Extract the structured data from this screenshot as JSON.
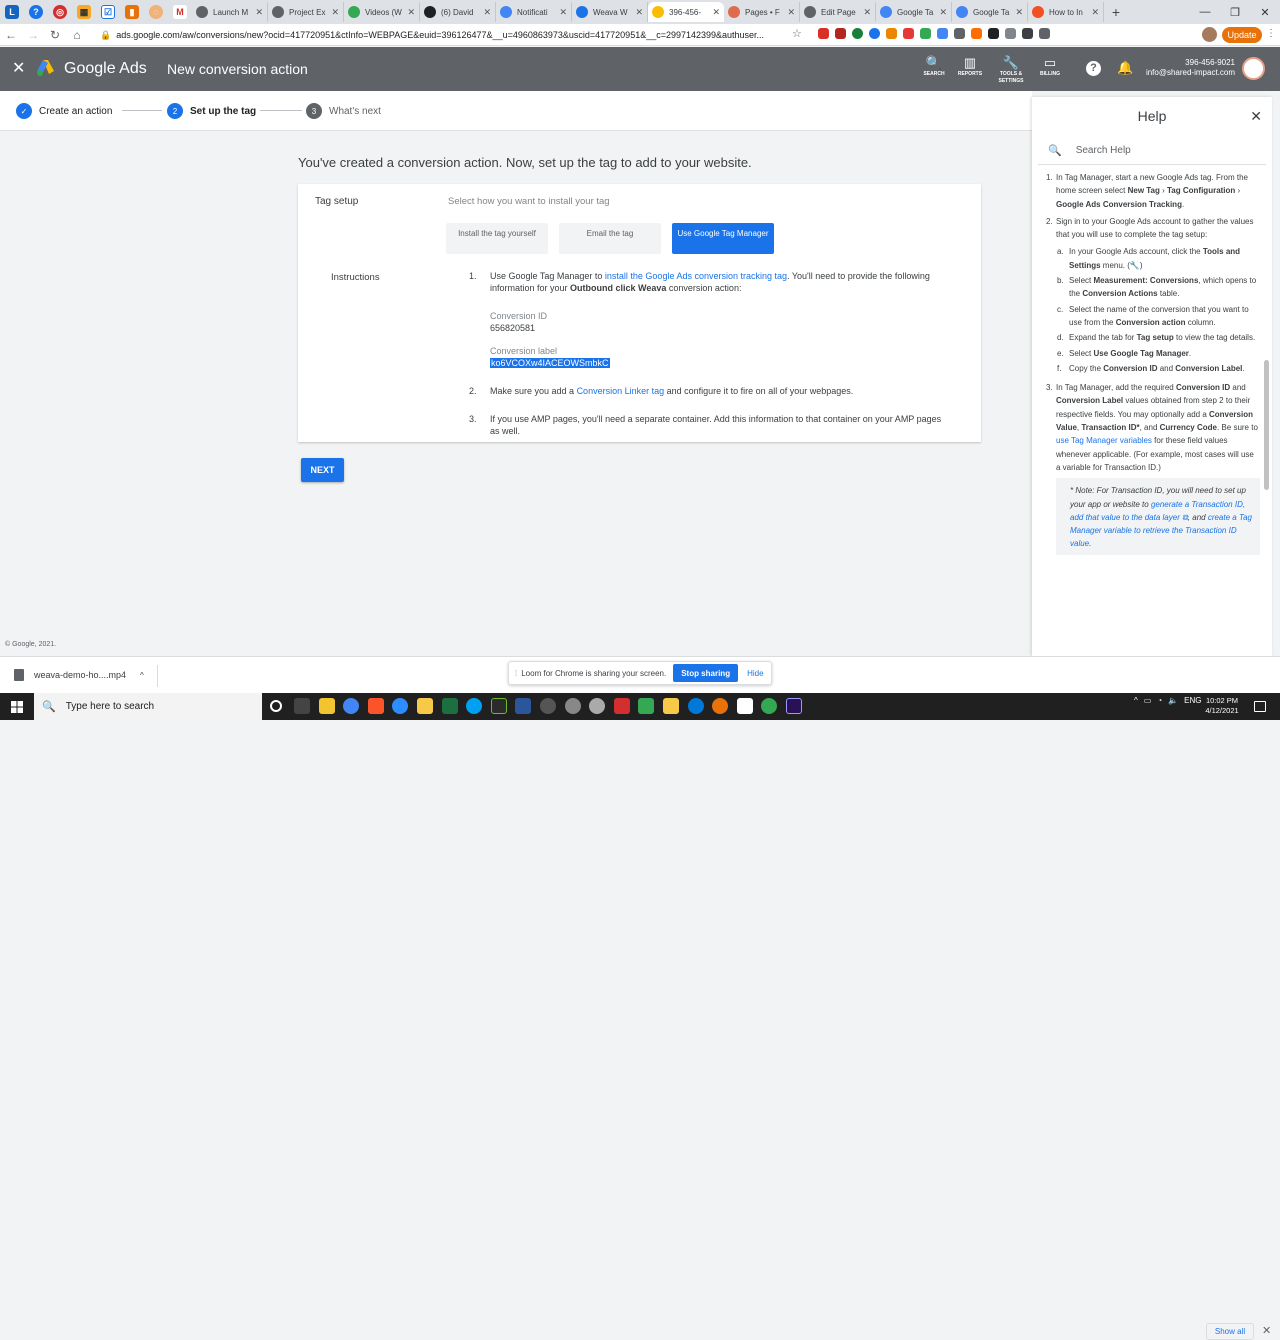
{
  "browser": {
    "tabs": [
      {
        "label": "Launch M",
        "color": "#5f6368"
      },
      {
        "label": "Project Ex",
        "color": "#5f6368"
      },
      {
        "label": "Videos (W",
        "color": "#34a853"
      },
      {
        "label": "(6) David",
        "color": "#202124"
      },
      {
        "label": "Notificati",
        "color": "#4285f4"
      },
      {
        "label": "Weava W",
        "color": "#1a73e8"
      },
      {
        "label": "396-456-",
        "color": "#fbbc04",
        "active": true
      },
      {
        "label": "Pages • F",
        "color": "#e06c4f"
      },
      {
        "label": "Edit Page",
        "color": "#5f6368"
      },
      {
        "label": "Google Ta",
        "color": "#4285f4"
      },
      {
        "label": "Google Ta",
        "color": "#4285f4"
      },
      {
        "label": "How to In",
        "color": "#f25022"
      }
    ],
    "url": "ads.google.com/aw/conversions/new?ocid=417720951&ctInfo=WEBPAGE&euid=396126477&__u=4960863973&uscid=417720951&__c=2997142399&authuser...",
    "update_label": "Update"
  },
  "header": {
    "brand": "Google Ads",
    "title": "New conversion action",
    "icons": [
      {
        "glyph": "🔍",
        "label": "SEARCH"
      },
      {
        "glyph": "▥",
        "label": "REPORTS"
      },
      {
        "glyph": "🔧",
        "label": "TOOLS & SETTINGS"
      },
      {
        "glyph": "▭",
        "label": "BILLING"
      }
    ],
    "account_id": "396-456-9021",
    "account_email": "info@shared-impact.com"
  },
  "stepper": {
    "step1": "Create an action",
    "step2_num": "2",
    "step2": "Set up the tag",
    "step3_num": "3",
    "step3": "What's next"
  },
  "main": {
    "headline": "You've created a conversion action. Now, set up the tag to add to your website.",
    "tag_setup_label": "Tag setup",
    "select_how": "Select how you want to install your tag",
    "options": [
      "Install the tag yourself",
      "Email the tag",
      "Use Google Tag Manager"
    ],
    "instructions_label": "Instructions",
    "step1_pre": "Use Google Tag Manager to ",
    "step1_link": "install the Google Ads conversion tracking tag",
    "step1_mid": ". You'll need to provide the following information for your ",
    "step1_bold": "Outbound click Weava",
    "step1_post": " conversion action:",
    "conv_id_label": "Conversion ID",
    "conv_id_value": "656820581",
    "conv_label_label": "Conversion label",
    "conv_label_value": "ko6VCOXw4IACEOWSmbkC",
    "step2_pre": "Make sure you add a ",
    "step2_link": "Conversion Linker tag",
    "step2_post": " and configure it to fire on all of your webpages.",
    "step3_text": "If you use AMP pages, you'll need a separate container. Add this information to that container on your AMP pages as well.",
    "next_label": "NEXT",
    "copyright": "© Google, 2021."
  },
  "help": {
    "title": "Help",
    "search_placeholder": "Search Help",
    "i1_a": "In Tag Manager, start a new Google Ads tag. From the home screen select ",
    "i1_b": "New Tag",
    "i1_c": " › ",
    "i1_d": "Tag Configuration",
    "i1_e": " › ",
    "i1_f": "Google Ads Conversion Tracking",
    "i1_g": ".",
    "i2": "Sign in to your Google Ads account to gather the values that you will use to complete the tag setup:",
    "a_pre": "In your Google Ads account, click the ",
    "a_bold": "Tools and Settings",
    "a_post": " menu. (🔧)",
    "b_pre": "Select ",
    "b_bold": "Measurement: Conversions",
    "b_mid": ", which opens to the ",
    "b_bold2": "Conversion Actions",
    "b_post": " table.",
    "c_pre": "Select the name of the conversion that you want to use from the ",
    "c_bold": "Conversion action",
    "c_post": " column.",
    "d_pre": "Expand the tab for ",
    "d_bold": "Tag setup",
    "d_post": " to view the tag details.",
    "e_pre": "Select ",
    "e_bold": "Use Google Tag Manager",
    "e_post": ".",
    "f_pre": "Copy the ",
    "f_bold": "Conversion ID",
    "f_mid": " and ",
    "f_bold2": "Conversion Label",
    "f_post": ".",
    "i3_pre": "In Tag Manager, add the required ",
    "i3_b1": "Conversion ID",
    "i3_t1": " and ",
    "i3_b2": "Conversion Label",
    "i3_t2": " values obtained from step 2 to their respective fields. You may optionally add a ",
    "i3_b3": "Conversion Value",
    "i3_t3": ", ",
    "i3_b4": "Transaction ID*",
    "i3_t4": ", and ",
    "i3_b5": "Currency Code",
    "i3_t5": ". Be sure to ",
    "i3_link": "use Tag Manager variables",
    "i3_t6": " for these field values whenever applicable. (For example, most cases will use a variable for Transaction ID.)",
    "note_pre": "* Note: For Transaction ID, you will need to set up your app or website to ",
    "note_link1": "generate a Transaction ID, add that value to the data layer ⧉",
    "note_mid": ", and ",
    "note_link2": "create a Tag Manager variable to retrieve the Transaction ID value",
    "note_post": "."
  },
  "downloads": {
    "file": "weava-demo-ho....mp4",
    "show_all": "Show all"
  },
  "loom": {
    "message": "Loom for Chrome is sharing your screen.",
    "stop": "Stop sharing",
    "hide": "Hide"
  },
  "taskbar": {
    "search_placeholder": "Type here to search",
    "lang": "ENG",
    "time": "10:02 PM",
    "date": "4/12/2021"
  }
}
